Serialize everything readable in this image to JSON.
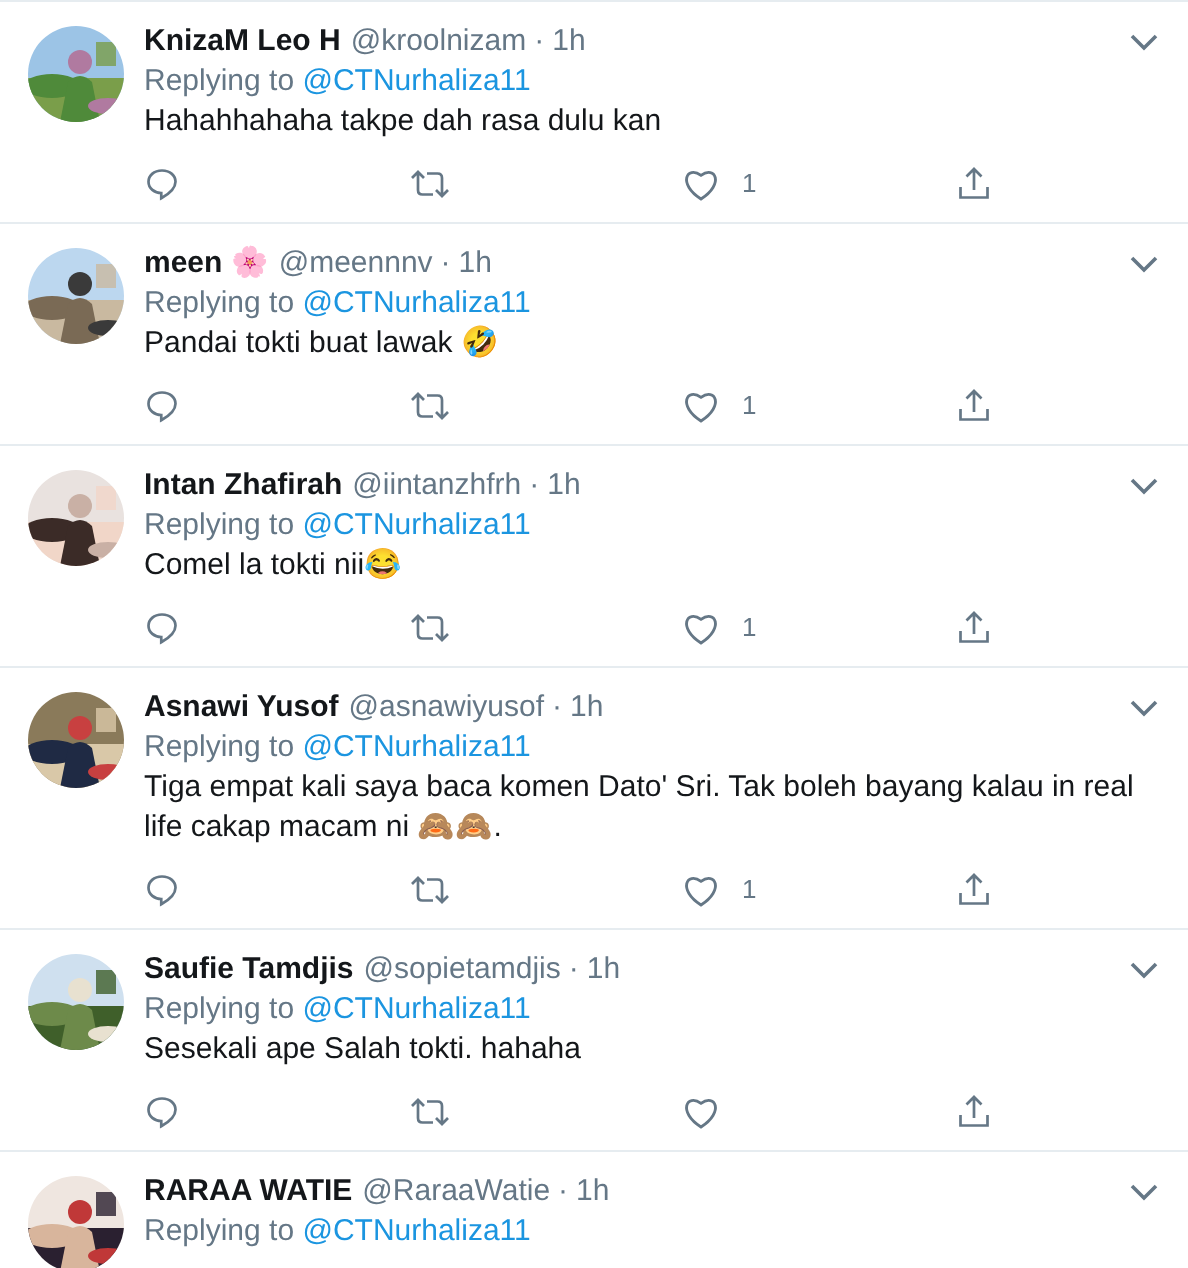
{
  "tweets": [
    {
      "name": "KnizaM Leo H",
      "handle": "@kroolnizam",
      "separator": "·",
      "time": "1h",
      "replying_label": "Replying to",
      "replying_to": "@CTNurhaliza11",
      "text": "Hahahhahaha takpe dah rasa dulu kan",
      "likes": "1"
    },
    {
      "name": "meen 🌸",
      "handle": "@meennnv",
      "separator": "·",
      "time": "1h",
      "replying_label": "Replying to",
      "replying_to": "@CTNurhaliza11",
      "text": "Pandai tokti buat lawak 🤣",
      "likes": "1"
    },
    {
      "name": "Intan Zhafirah",
      "handle": "@iintanzhfrh",
      "separator": "·",
      "time": "1h",
      "replying_label": "Replying to",
      "replying_to": "@CTNurhaliza11",
      "text": "Comel la tokti nii😂",
      "likes": "1"
    },
    {
      "name": "Asnawi Yusof",
      "handle": "@asnawiyusof",
      "separator": "·",
      "time": "1h",
      "replying_label": "Replying to",
      "replying_to": "@CTNurhaliza11",
      "text": "Tiga empat kali saya baca komen Dato' Sri. Tak boleh bayang kalau in real life cakap macam ni 🙈🙈.",
      "likes": "1"
    },
    {
      "name": "Saufie Tamdjis",
      "handle": "@sopietamdjis",
      "separator": "·",
      "time": "1h",
      "replying_label": "Replying to",
      "replying_to": "@CTNurhaliza11",
      "text": "Sesekali ape Salah tokti. hahaha"
    },
    {
      "name": "RARAA WATIE",
      "handle": "@RaraaWatie",
      "separator": "·",
      "time": "1h",
      "replying_label": "Replying to",
      "replying_to": "@CTNurhaliza11"
    }
  ]
}
